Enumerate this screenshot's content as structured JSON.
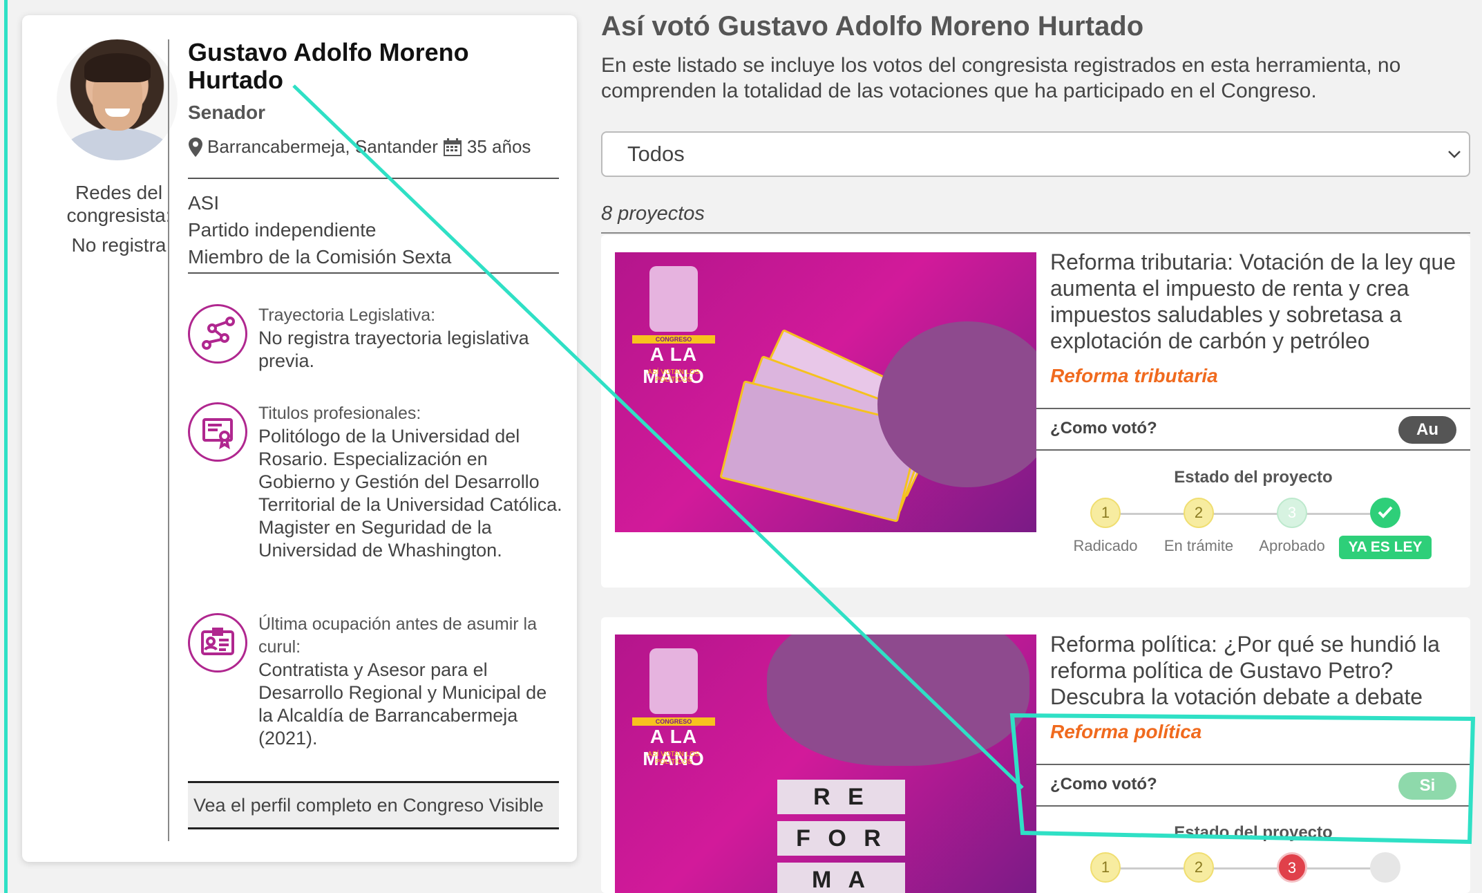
{
  "profile": {
    "name": "Gustavo Adolfo Moreno Hurtado",
    "role": "Senador",
    "location": "Barrancabermeja, Santander",
    "age": "35 años",
    "party_lines": [
      "ASI",
      "Partido independiente",
      "Miembro de la Comisión Sexta"
    ],
    "redes_label": "Redes del congresista:",
    "redes_value": "No registra",
    "trayectoria": {
      "heading": "Trayectoria Legislativa:",
      "text": "No registra trayectoria legislativa previa.",
      "icon": "route-icon"
    },
    "titulos": {
      "heading": "Titulos profesionales:",
      "text": "Politólogo de la Universidad del Rosario. Especialización en Gobierno y Gestión del Desarrollo Territorial de la Universidad Católica. Magister en Seguridad de la Universidad de Whashington.",
      "icon": "certificate-icon"
    },
    "ocupacion": {
      "heading": "Última ocupación antes de asumir la curul:",
      "text": "Contratista y Asesor para el Desarrollo Regional y Municipal de la Alcaldía de Barrancabermeja (2021).",
      "icon": "id-card-icon"
    },
    "full_profile_link": "Vea el perfil completo en Congreso Visible"
  },
  "main": {
    "title": "Así votó Gustavo Adolfo Moreno Hurtado",
    "subtitle": "En este listado se incluye los votos del congresista registrados en esta herramienta, no comprenden la totalidad de las votaciones que ha participado en el Congreso.",
    "filter_value": "Todos",
    "count": "8 proyectos"
  },
  "logo": {
    "top": "CONGRESO",
    "big": "A LA MANO",
    "small": "ASÍ VOTAN LOS POLÍTICOS"
  },
  "projects": [
    {
      "title": "Reforma tributaria: Votación de la ley que aumenta el impuesto de renta y crea impuestos saludables y sobretasa a explotación de carbón y petróleo",
      "tag": "Reforma tributaria",
      "vote_label": "¿Como votó?",
      "vote": "Au",
      "estado_label": "Estado del proyecto",
      "steps": [
        {
          "num": "1",
          "label": "Radicado"
        },
        {
          "num": "2",
          "label": "En trámite"
        },
        {
          "num": "3",
          "label": "Aprobado"
        },
        {
          "num": "",
          "label": "YA ES LEY"
        }
      ]
    },
    {
      "title": "Reforma política: ¿Por qué se hundió la reforma política de Gustavo Petro? Descubra la votación debate a debate",
      "tag": "Reforma política",
      "vote_label": "¿Como votó?",
      "vote": "Si",
      "estado_label": "Estado del proyecto",
      "steps": [
        {
          "num": "1"
        },
        {
          "num": "2"
        },
        {
          "num": "3"
        },
        {
          "num": ""
        }
      ],
      "image_letters": [
        "R E",
        "F O R",
        "M A"
      ]
    }
  ],
  "colors": {
    "accent_purple": "#b0278f",
    "tag_orange": "#f06a1e",
    "annotation_teal": "#2fe0c5",
    "vote_au": "#555555",
    "vote_si": "#7fd6a0",
    "step_yellow": "#f7eca0",
    "step_green": "#2ecf79",
    "step_red": "#e0404a"
  }
}
